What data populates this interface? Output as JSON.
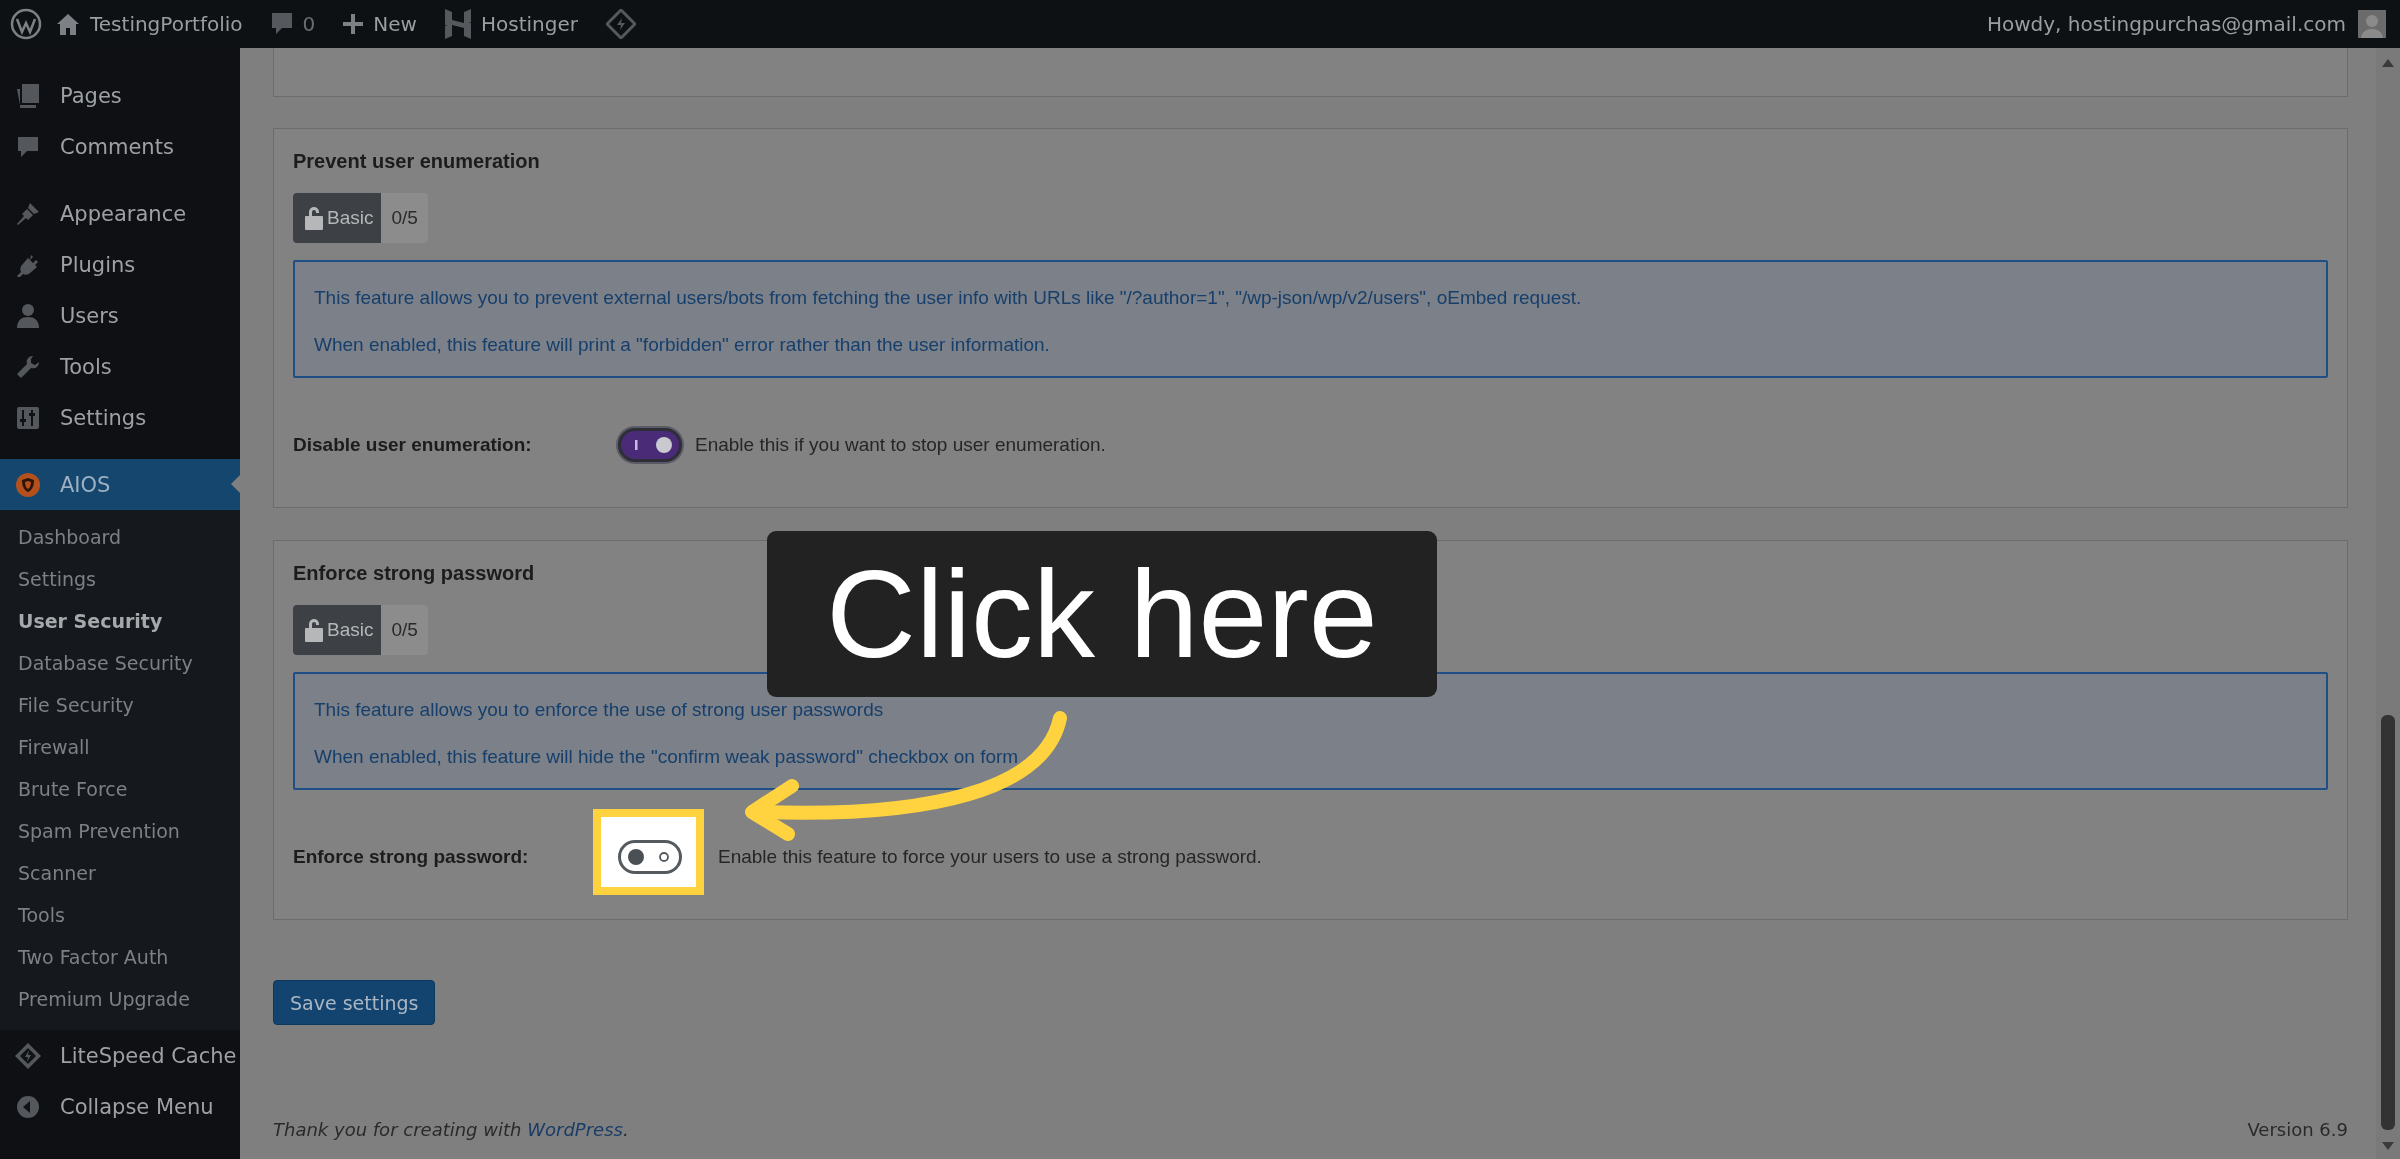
{
  "top_bar": {
    "site_name": "TestingPortfolio",
    "comments_count": "0",
    "new_label": "New",
    "hosting_label": "Hostinger",
    "greeting": "Howdy, hostingpurchas@gmail.com"
  },
  "sidebar": {
    "menu": [
      {
        "label": "Pages",
        "selected": false
      },
      {
        "label": "Comments",
        "selected": false
      },
      {
        "label": "Appearance",
        "selected": false
      },
      {
        "label": "Plugins",
        "selected": false
      },
      {
        "label": "Users",
        "selected": false
      },
      {
        "label": "Tools",
        "selected": false
      },
      {
        "label": "Settings",
        "selected": false
      },
      {
        "label": "AIOS",
        "selected": true,
        "submenu": [
          {
            "label": "Dashboard",
            "selected": false
          },
          {
            "label": "Settings",
            "selected": false
          },
          {
            "label": "User Security",
            "selected": true
          },
          {
            "label": "Database Security",
            "selected": false
          },
          {
            "label": "File Security",
            "selected": false
          },
          {
            "label": "Firewall",
            "selected": false
          },
          {
            "label": "Brute Force",
            "selected": false
          },
          {
            "label": "Spam Prevention",
            "selected": false
          },
          {
            "label": "Scanner",
            "selected": false
          },
          {
            "label": "Tools",
            "selected": false
          },
          {
            "label": "Two Factor Auth",
            "selected": false
          },
          {
            "label": "Premium Upgrade",
            "selected": false
          }
        ]
      },
      {
        "label": "LiteSpeed Cache",
        "selected": false
      },
      {
        "label": "Collapse Menu",
        "selected": false
      }
    ]
  },
  "sections": [
    {
      "title": "Prevent user enumeration",
      "badge_label": "Basic",
      "badge_score": "0/5",
      "info": [
        "This feature allows you to prevent external users/bots from fetching the user info with URLs like \"/?author=1\", \"/wp-json/wp/v2/users\", oEmbed request.",
        "When enabled, this feature will print a \"forbidden\" error rather than the user information."
      ],
      "setting_label": "Disable user enumeration:",
      "toggle_on": true,
      "highlighted": false,
      "description": "Enable this if you want to stop user enumeration."
    },
    {
      "title": "Enforce strong password",
      "badge_label": "Basic",
      "badge_score": "0/5",
      "info": [
        "This feature allows you to enforce the use of strong user passwords",
        "When enabled, this feature will hide the \"confirm weak password\" checkbox on form"
      ],
      "setting_label": "Enforce strong password:",
      "toggle_on": false,
      "highlighted": true,
      "description": "Enable this feature to force your users to use a strong password."
    }
  ],
  "save_button": "Save settings",
  "footer": {
    "text": "Thank you for creating with ",
    "link": "WordPress",
    "suffix": ".",
    "version": "Version 6.9"
  },
  "tutorial": {
    "callout": "Click here"
  }
}
